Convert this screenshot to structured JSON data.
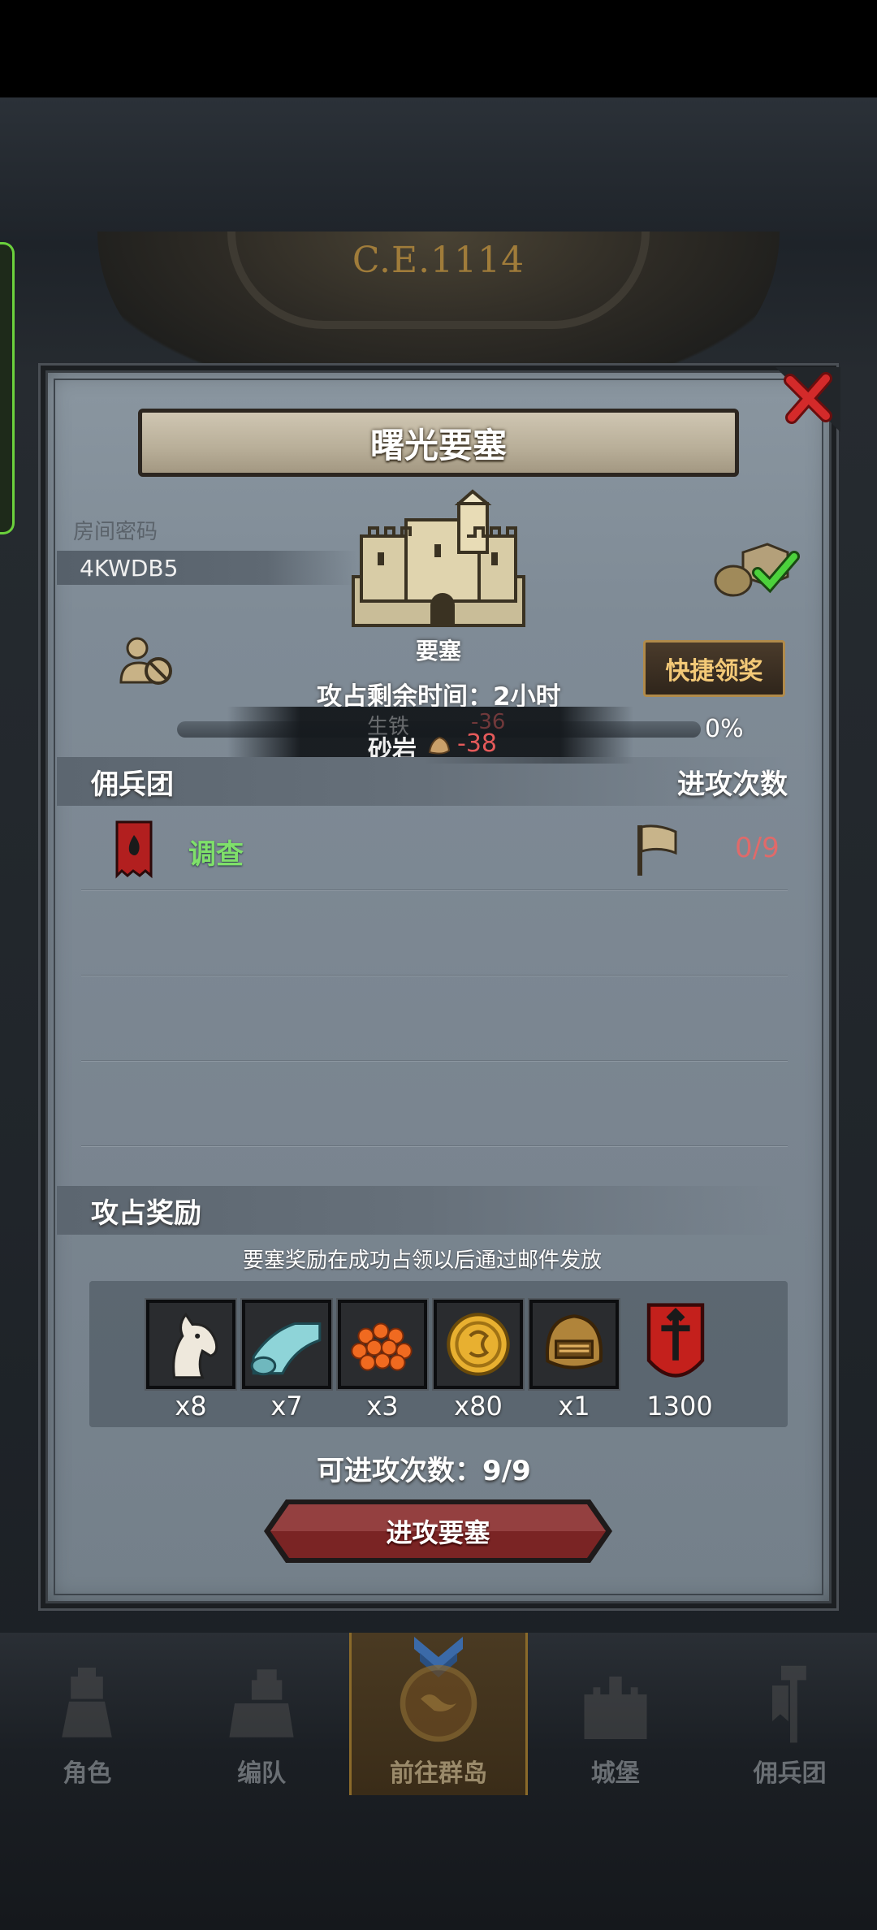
{
  "world": {
    "era_label": "C.E.1114"
  },
  "dialog": {
    "title": "曙光要塞",
    "room_code_label": "房间密码",
    "room_code": "4KWDB5",
    "castle_label": "要塞",
    "claim_button": "快捷领奖",
    "occupy_time_text": "攻占剩余时间：2小时",
    "progress_percent": "0%",
    "progress_value": 0,
    "resource_popup": {
      "ghost_name": "生铁",
      "ghost_value": "-36",
      "name": "砂岩",
      "value": "-38",
      "icon": "sandstone-icon"
    },
    "mercenary_header": "佣兵团",
    "attack_count_header": "进攻次数",
    "mercenaries": [
      {
        "name": "调查",
        "count": "0/9",
        "icon": "fire-banner-icon"
      }
    ],
    "reward_header": "攻占奖励",
    "reward_note": "要塞奖励在成功占领以后通过邮件发放",
    "rewards": [
      {
        "icon": "horse-icon",
        "qty": "x8"
      },
      {
        "icon": "cloth-icon",
        "qty": "x7"
      },
      {
        "icon": "berries-icon",
        "qty": "x3"
      },
      {
        "icon": "gold-coin-icon",
        "qty": "x80"
      },
      {
        "icon": "helmet-icon",
        "qty": "x1"
      },
      {
        "icon": "guild-banner-icon",
        "qty": "1300"
      }
    ],
    "available_attacks": "可进攻次数：9/9",
    "attack_button": "进攻要塞"
  },
  "nav": {
    "items": [
      {
        "label": "角色",
        "icon": "knight-icon"
      },
      {
        "label": "编队",
        "icon": "formation-icon"
      },
      {
        "label": "前往群岛",
        "icon": "islands-icon"
      },
      {
        "label": "城堡",
        "icon": "castle-icon"
      },
      {
        "label": "佣兵团",
        "icon": "mercenary-icon"
      }
    ]
  },
  "colors": {
    "accent_green": "#7fe06a",
    "count_red": "#e06a6a",
    "claim_gold": "#f3c977",
    "attack_red": "#7a2424"
  }
}
